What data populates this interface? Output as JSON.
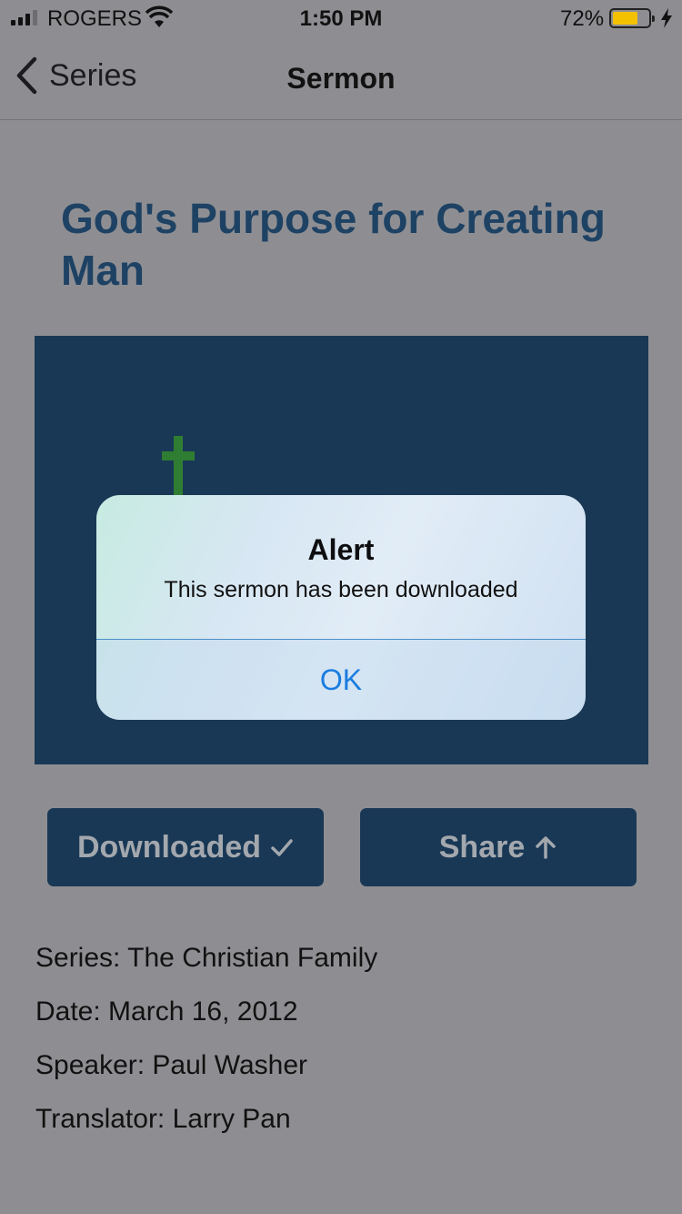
{
  "status_bar": {
    "carrier": "ROGERS",
    "time": "1:50 PM",
    "battery_percent": "72%",
    "battery_level": 0.72,
    "icons": [
      "signal-icon",
      "wifi-icon",
      "battery-icon",
      "charging-icon"
    ]
  },
  "nav": {
    "back_label": "Series",
    "title": "Sermon"
  },
  "sermon": {
    "title": "God's Purpose for Creating Man",
    "artwork_icon": "cross-icon",
    "colors": {
      "title": "#1e4264",
      "artwork_bg": "#193855",
      "cross": "#2e7d32"
    }
  },
  "actions": {
    "download_label": "Downloaded",
    "download_icon": "checkmark-icon",
    "share_label": "Share",
    "share_icon": "arrow-up-icon"
  },
  "details": {
    "series": "Series: The Christian Family",
    "date": "Date: March 16, 2012",
    "speaker": "Speaker: Paul Washer",
    "translator": "Translator: Larry Pan"
  },
  "alert": {
    "title": "Alert",
    "message": "This sermon has been downloaded",
    "ok_label": "OK",
    "accent": "#1a7ce0"
  }
}
